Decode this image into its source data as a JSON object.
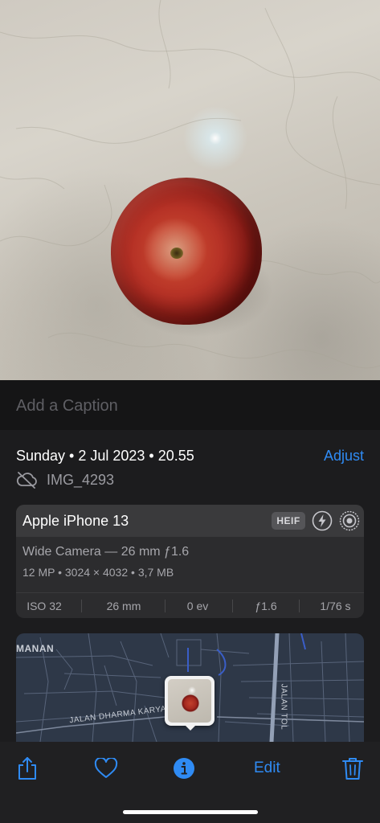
{
  "caption": {
    "placeholder": "Add a Caption"
  },
  "metadata": {
    "date_time": "Sunday • 2 Jul 2023 • 20.55",
    "adjust_label": "Adjust",
    "filename": "IMG_4293",
    "filename_icon": "cloud-slash-icon"
  },
  "camera_card": {
    "device": "Apple iPhone 13",
    "format_badge": "HEIF",
    "flash_icon": "flash-icon",
    "live_icon": "live-photo-icon",
    "lens": "Wide Camera — 26 mm ƒ1.6",
    "specs": "12 MP • 3024 × 4032 • 3,7 MB",
    "exif": {
      "iso": "ISO 32",
      "focal_length": "26 mm",
      "exposure": "0 ev",
      "aperture": "ƒ1.6",
      "shutter": "1/76 s"
    }
  },
  "map": {
    "label_top": "MANAN",
    "road_label_1": "JALAN DHARMA KARYA",
    "road_label_2": "JALAN TOL"
  },
  "toolbar": {
    "share_icon": "share-icon",
    "favorite_icon": "heart-icon",
    "info_icon": "info-icon",
    "edit_label": "Edit",
    "delete_icon": "trash-icon"
  },
  "colors": {
    "accent": "#2f8bf4",
    "background": "#1c1c1e",
    "card": "#2c2c2e"
  }
}
